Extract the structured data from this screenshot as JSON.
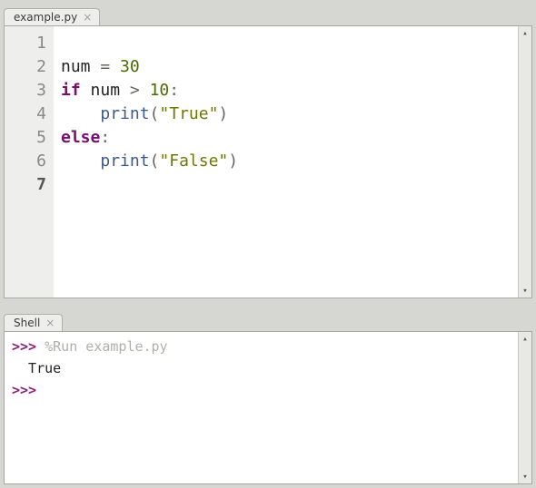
{
  "editor": {
    "tab_label": "example.py",
    "line_numbers": [
      "1",
      "2",
      "3",
      "4",
      "5",
      "6",
      "7"
    ],
    "current_line": 7,
    "code": {
      "l2_name": "num",
      "l2_op1": " = ",
      "l2_num": "30",
      "l3_kw": "if",
      "l3_sp1": " ",
      "l3_name": "num",
      "l3_op": " > ",
      "l3_num": "10",
      "l3_colon": ":",
      "l4_indent": "    ",
      "l4_func": "print",
      "l4_lp": "(",
      "l4_str": "\"True\"",
      "l4_rp": ")",
      "l5_kw": "else",
      "l5_colon": ":",
      "l6_indent": "    ",
      "l6_func": "print",
      "l6_lp": "(",
      "l6_str": "\"False\"",
      "l6_rp": ")"
    }
  },
  "shell": {
    "tab_label": "Shell",
    "prompt": ">>>",
    "run_line": " %Run example.py",
    "output": "  True"
  },
  "scrollbar": {
    "up": "▴",
    "down": "▾"
  },
  "tab_close": "×"
}
